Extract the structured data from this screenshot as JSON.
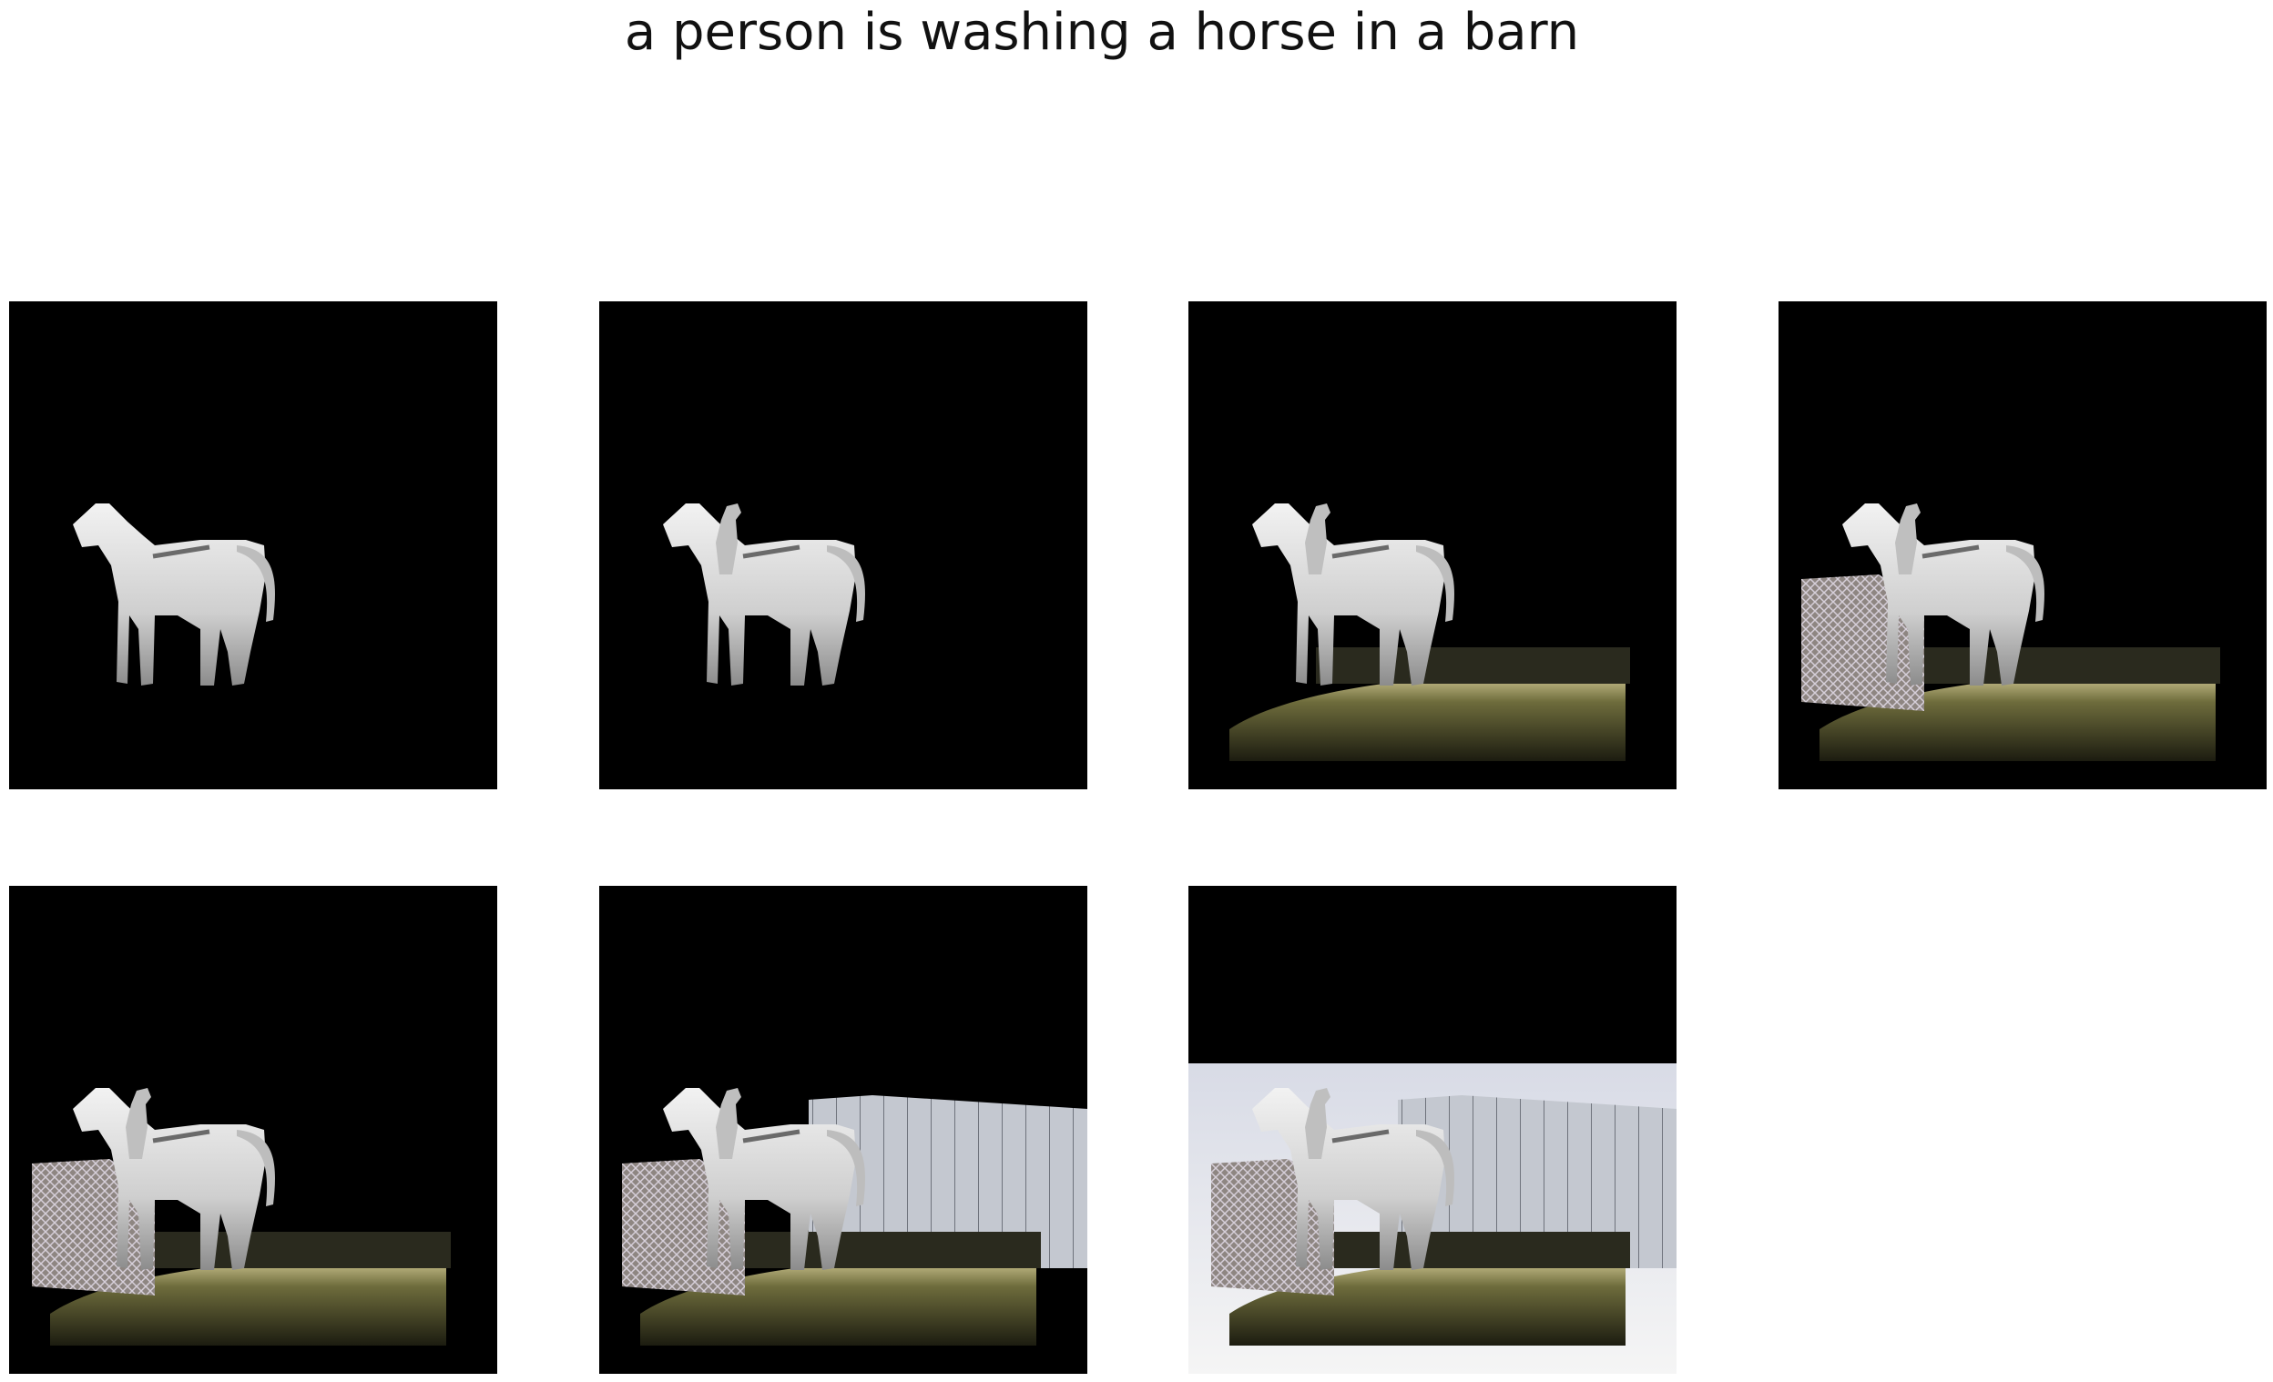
{
  "figure": {
    "title": "a person is washing a horse in a barn"
  },
  "panels": [
    {
      "id": "step-1",
      "layers": [
        "horse"
      ]
    },
    {
      "id": "step-2",
      "layers": [
        "horse",
        "person"
      ]
    },
    {
      "id": "step-3",
      "layers": [
        "horse",
        "person",
        "ground",
        "trailer"
      ]
    },
    {
      "id": "step-4",
      "layers": [
        "horse",
        "person",
        "ground",
        "trailer",
        "fence"
      ]
    },
    {
      "id": "step-5",
      "layers": [
        "horse",
        "person",
        "ground",
        "trailer",
        "fence"
      ]
    },
    {
      "id": "step-6",
      "layers": [
        "horse",
        "person",
        "ground",
        "trailer",
        "fence",
        "barn-wall"
      ]
    },
    {
      "id": "step-7",
      "layers": [
        "horse",
        "person",
        "ground",
        "trailer",
        "fence",
        "barn-wall",
        "sky"
      ]
    }
  ],
  "colors": {
    "background": "#000000",
    "horse": "#d9d9d9",
    "ground": "#6b6a3a",
    "fence": "#9a8f8a",
    "wall": "#c9ccd4",
    "sky": "#eeeeee"
  }
}
